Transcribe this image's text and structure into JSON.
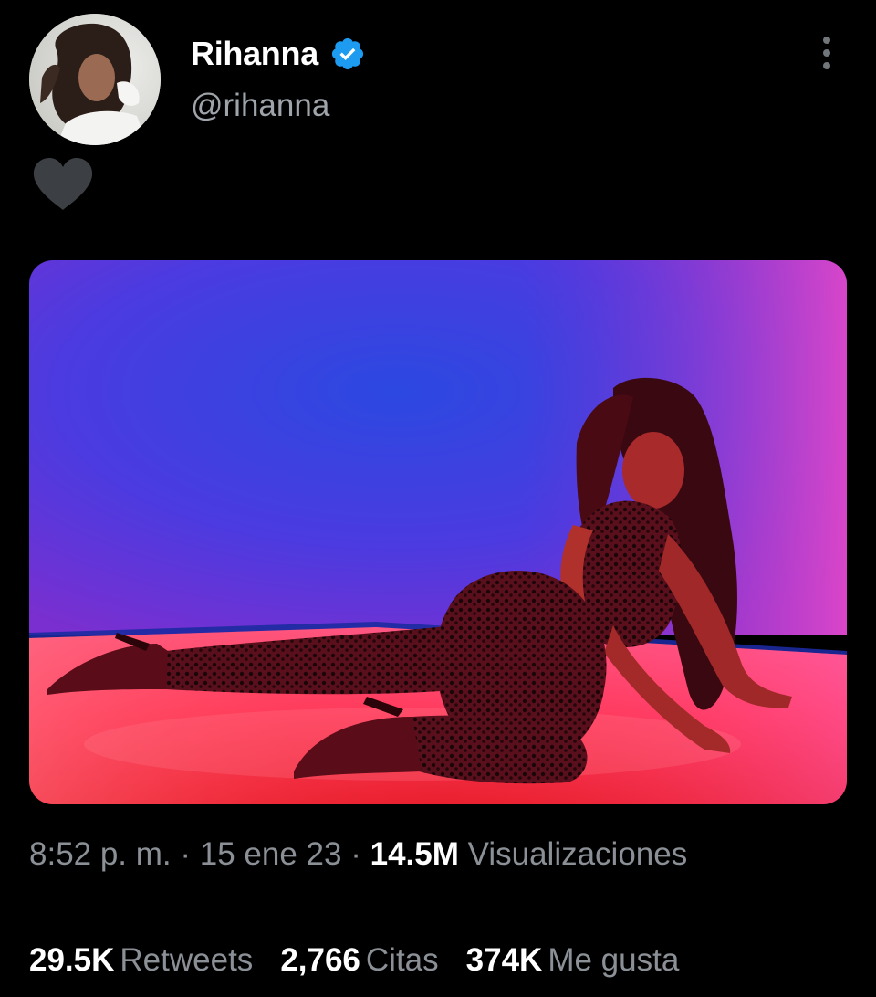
{
  "tweet": {
    "author": {
      "display_name": "Rihanna",
      "handle": "@rihanna",
      "verified": true,
      "avatar_icon": "avatar-photo",
      "verified_icon": "verified-badge-icon"
    },
    "text_emoji": "black-heart",
    "media": {
      "type": "photo"
    },
    "time": "8:52 p. m.",
    "separator": "·",
    "date": "15 ene 23",
    "views_count": "14.5M",
    "views_label": "Visualizaciones",
    "stats": [
      {
        "count": "29.5K",
        "label": "Retweets"
      },
      {
        "count": "2,766",
        "label": "Citas"
      },
      {
        "count": "374K",
        "label": "Me gusta"
      }
    ],
    "more_icon": "more-vertical-icon"
  },
  "colors": {
    "background": "#000000",
    "text_primary": "#ffffff",
    "text_secondary": "#8b9096",
    "verified_blue": "#1d9bf0",
    "divider": "#2f3336",
    "heart": "#3c4045"
  }
}
